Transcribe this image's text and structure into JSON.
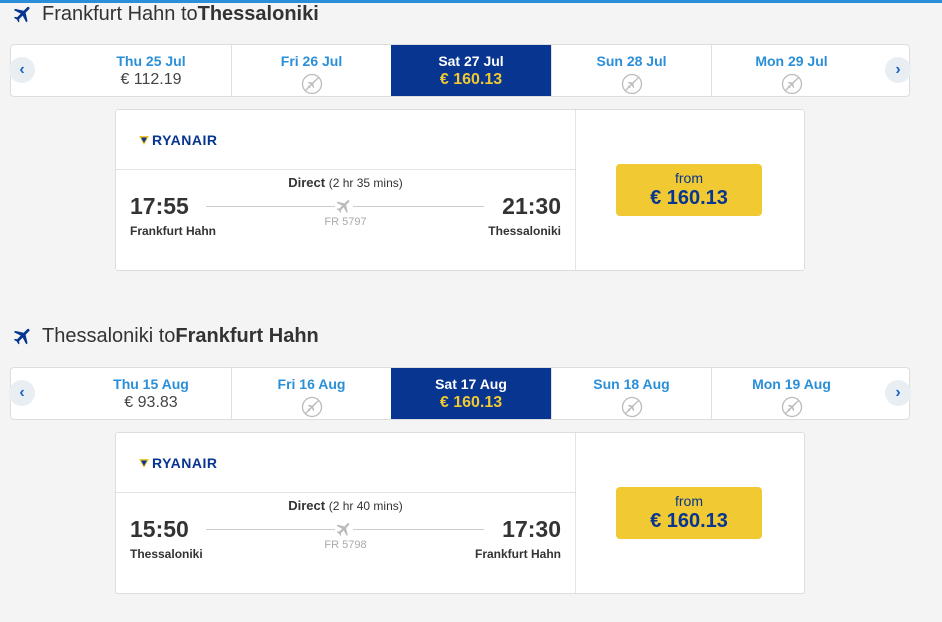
{
  "outbound": {
    "heading_prefix": "Frankfurt Hahn to ",
    "heading_dest": "Thessaloniki",
    "dates": [
      {
        "label": "Thu 25 Jul",
        "price": "€ 112.19",
        "available": true,
        "selected": false
      },
      {
        "label": "Fri 26 Jul",
        "price": "",
        "available": false,
        "selected": false
      },
      {
        "label": "Sat 27 Jul",
        "price": "€ 160.13",
        "available": true,
        "selected": true
      },
      {
        "label": "Sun 28 Jul",
        "price": "",
        "available": false,
        "selected": false
      },
      {
        "label": "Mon 29 Jul",
        "price": "",
        "available": false,
        "selected": false
      }
    ],
    "flight": {
      "airline": "RYANAIR",
      "direct": "Direct",
      "duration": "(2 hr 35 mins)",
      "dep_time": "17:55",
      "arr_time": "21:30",
      "dep_city": "Frankfurt Hahn",
      "arr_city": "Thessaloniki",
      "flight_no": "FR 5797",
      "from_label": "from",
      "price": "€ 160.13"
    }
  },
  "return": {
    "heading_prefix": "Thessaloniki to ",
    "heading_dest": "Frankfurt Hahn",
    "dates": [
      {
        "label": "Thu 15 Aug",
        "price": "€ 93.83",
        "available": true,
        "selected": false
      },
      {
        "label": "Fri 16 Aug",
        "price": "",
        "available": false,
        "selected": false
      },
      {
        "label": "Sat 17 Aug",
        "price": "€ 160.13",
        "available": true,
        "selected": true
      },
      {
        "label": "Sun 18 Aug",
        "price": "",
        "available": false,
        "selected": false
      },
      {
        "label": "Mon 19 Aug",
        "price": "",
        "available": false,
        "selected": false
      }
    ],
    "flight": {
      "airline": "RYANAIR",
      "direct": "Direct",
      "duration": "(2 hr 40 mins)",
      "dep_time": "15:50",
      "arr_time": "17:30",
      "dep_city": "Thessaloniki",
      "arr_city": "Frankfurt Hahn",
      "flight_no": "FR 5798",
      "from_label": "from",
      "price": "€ 160.13"
    }
  },
  "nav": {
    "prev": "‹",
    "next": "›"
  },
  "colors": {
    "brand_blue": "#073590",
    "link_blue": "#2a8fd8",
    "yellow": "#f1c933"
  },
  "icons": {
    "heading": "plane-icon",
    "no_flight": "no-flight-icon",
    "logo": "ryanair-harp-icon"
  }
}
